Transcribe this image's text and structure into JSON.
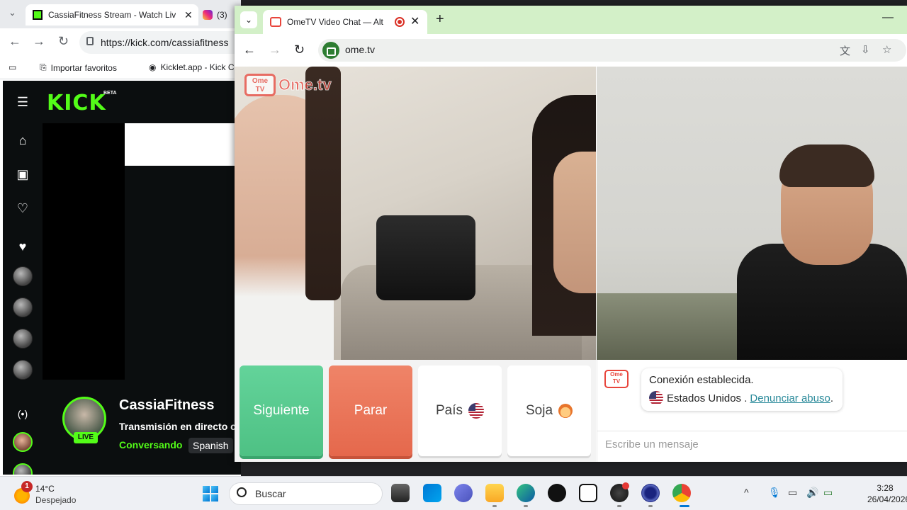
{
  "bg_browser": {
    "tab_title": "CassiaFitness Stream - Watch Live",
    "tab2_title": "(3)",
    "url": "https://kick.com/cassiafitness",
    "bookmarks": [
      "Importar favoritos",
      "Kicklet.app - Kick C"
    ]
  },
  "kick": {
    "logo": "KICK",
    "beta": "BETA",
    "streamer": "CassiaFitness",
    "live": "LIVE",
    "title": "Transmisión en directo c",
    "category": "Conversando",
    "language": "Spanish"
  },
  "fg_browser": {
    "tab_title": "OmeTV Video Chat — Alter",
    "url": "ome.tv",
    "accent": "#d3f0c8"
  },
  "ome": {
    "brand": "Ome.tv",
    "logo_top": "Ome",
    "logo_bottom": "TV",
    "buttons": {
      "next": "Siguiente",
      "stop": "Parar",
      "country": "País",
      "gender": "Soja"
    },
    "chat": {
      "line1": "Conexión establecida.",
      "country": "Estados Unidos .",
      "report": "Denunciar abuso",
      "report_suffix": ".",
      "placeholder": "Escribe un mensaje"
    }
  },
  "taskbar": {
    "notification_count": "1",
    "temperature": "14°C",
    "weather": "Despejado",
    "search_placeholder": "Buscar",
    "time": "3:28",
    "date": "26/04/2026"
  }
}
